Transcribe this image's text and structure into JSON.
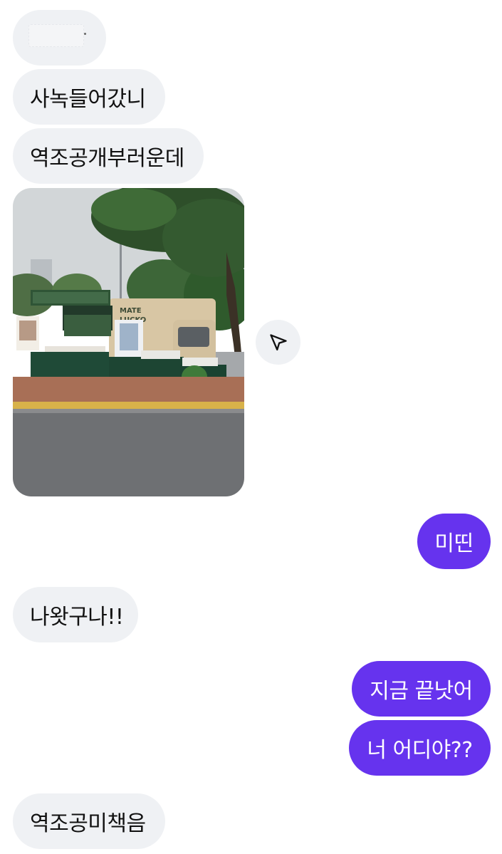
{
  "messages": {
    "m2": "사녹들어갔니",
    "m3": "역조공개부러운데",
    "m4": "미띤",
    "m5": "나왓구나!!",
    "m6": "지금 끝낫어",
    "m7": "너 어디야??",
    "m8": "역조공미책음"
  },
  "photo": {
    "sign_line1": "MATE",
    "sign_line2": "LUCKO"
  },
  "share": {
    "icon": "send-icon"
  },
  "colors": {
    "incoming_bubble": "#eff1f4",
    "outgoing_bubble": "#6633ee",
    "incoming_text": "#111111",
    "outgoing_text": "#ffffff"
  }
}
